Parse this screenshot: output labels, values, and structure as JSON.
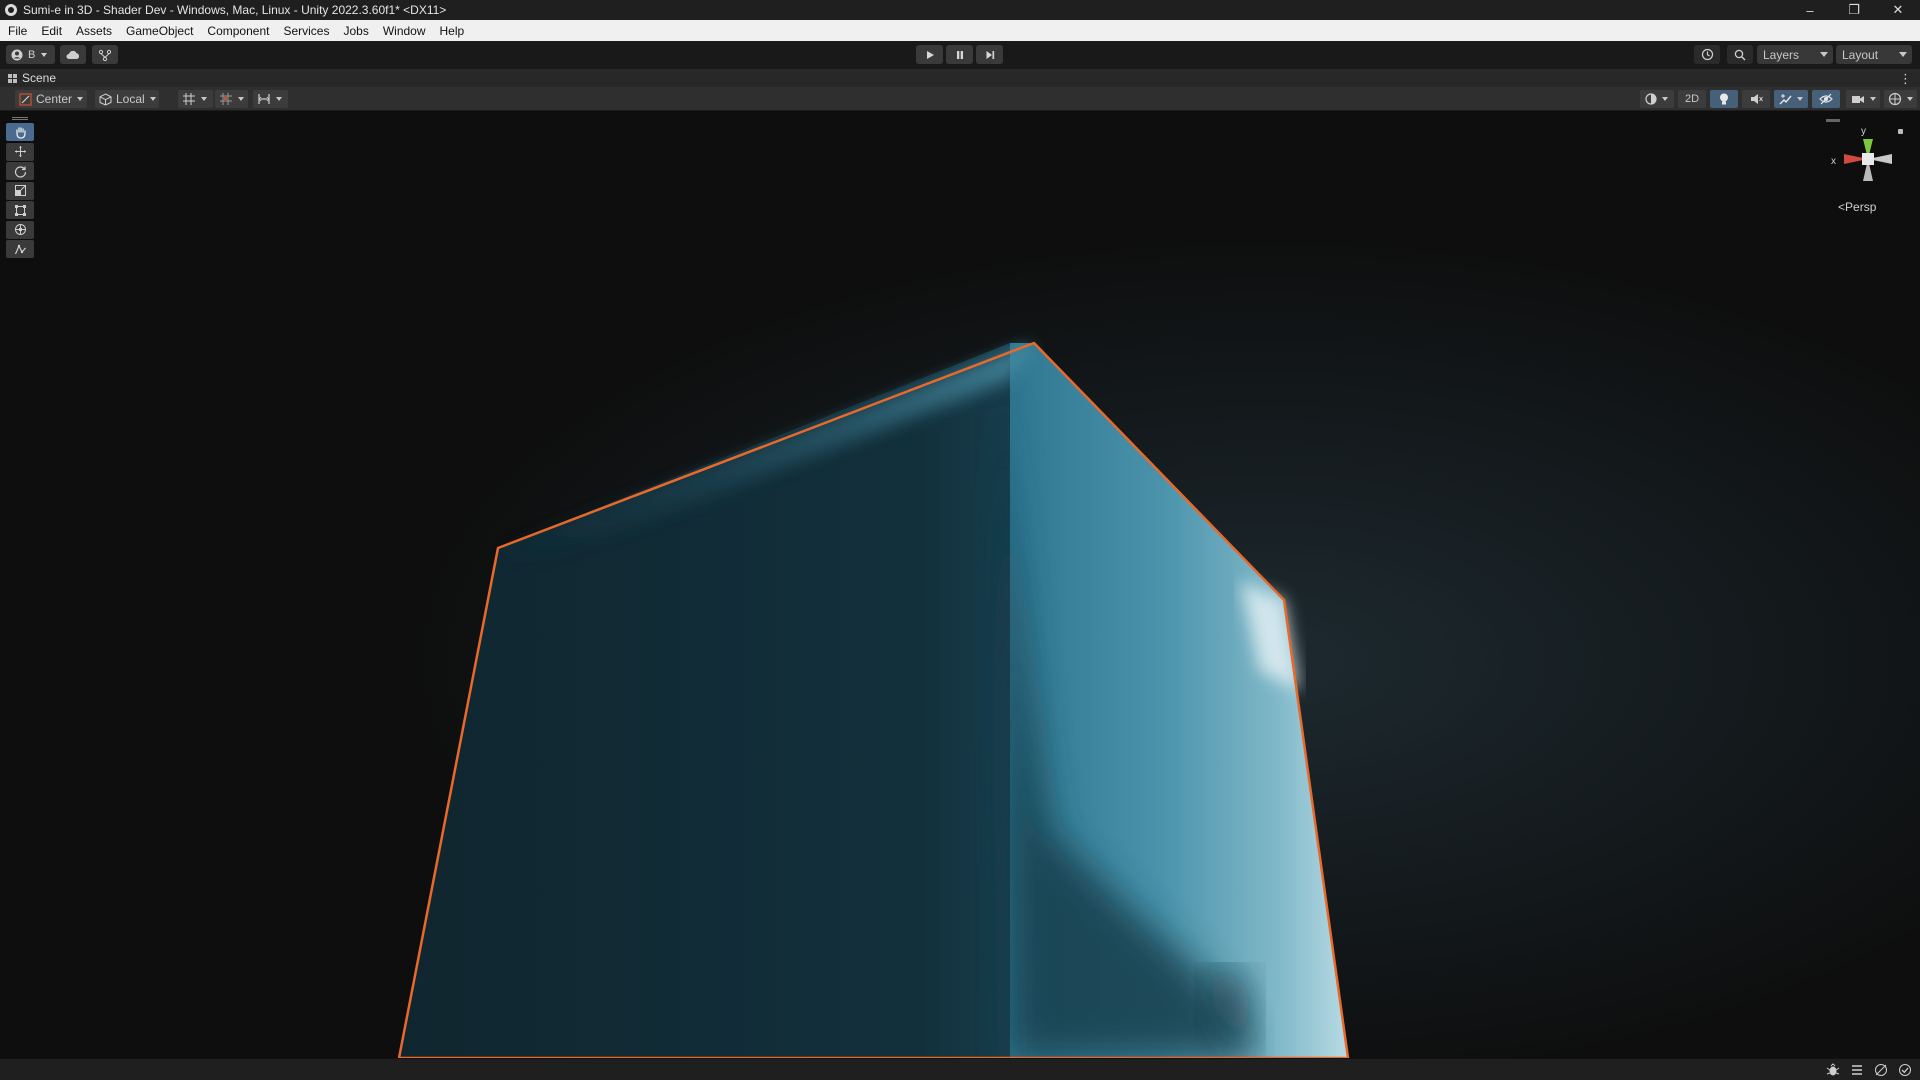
{
  "window": {
    "title": "Sumi-e in 3D - Shader Dev - Windows, Mac, Linux - Unity 2022.3.60f1* <DX11>",
    "controls": [
      "–",
      "❐",
      "✕"
    ]
  },
  "menu": [
    "File",
    "Edit",
    "Assets",
    "GameObject",
    "Component",
    "Services",
    "Jobs",
    "Window",
    "Help"
  ],
  "toolbar": {
    "account_label": "B",
    "layers_label": "Layers",
    "layout_label": "Layout"
  },
  "scene_tab": {
    "label": "Scene",
    "kebab": "⋮"
  },
  "scene_toolbar": {
    "pivot_label": "Center",
    "space_label": "Local",
    "mode_2d": "2D"
  },
  "gizmo": {
    "label": "Persp",
    "axis_x": "x",
    "axis_y": "y"
  },
  "colors": {
    "selection_outline": "#e8692a",
    "cube_dark": "#112a36",
    "cube_mid": "#3e8ba4",
    "cube_light": "#9cc7d3",
    "active_tool": "#4b6a8f"
  }
}
